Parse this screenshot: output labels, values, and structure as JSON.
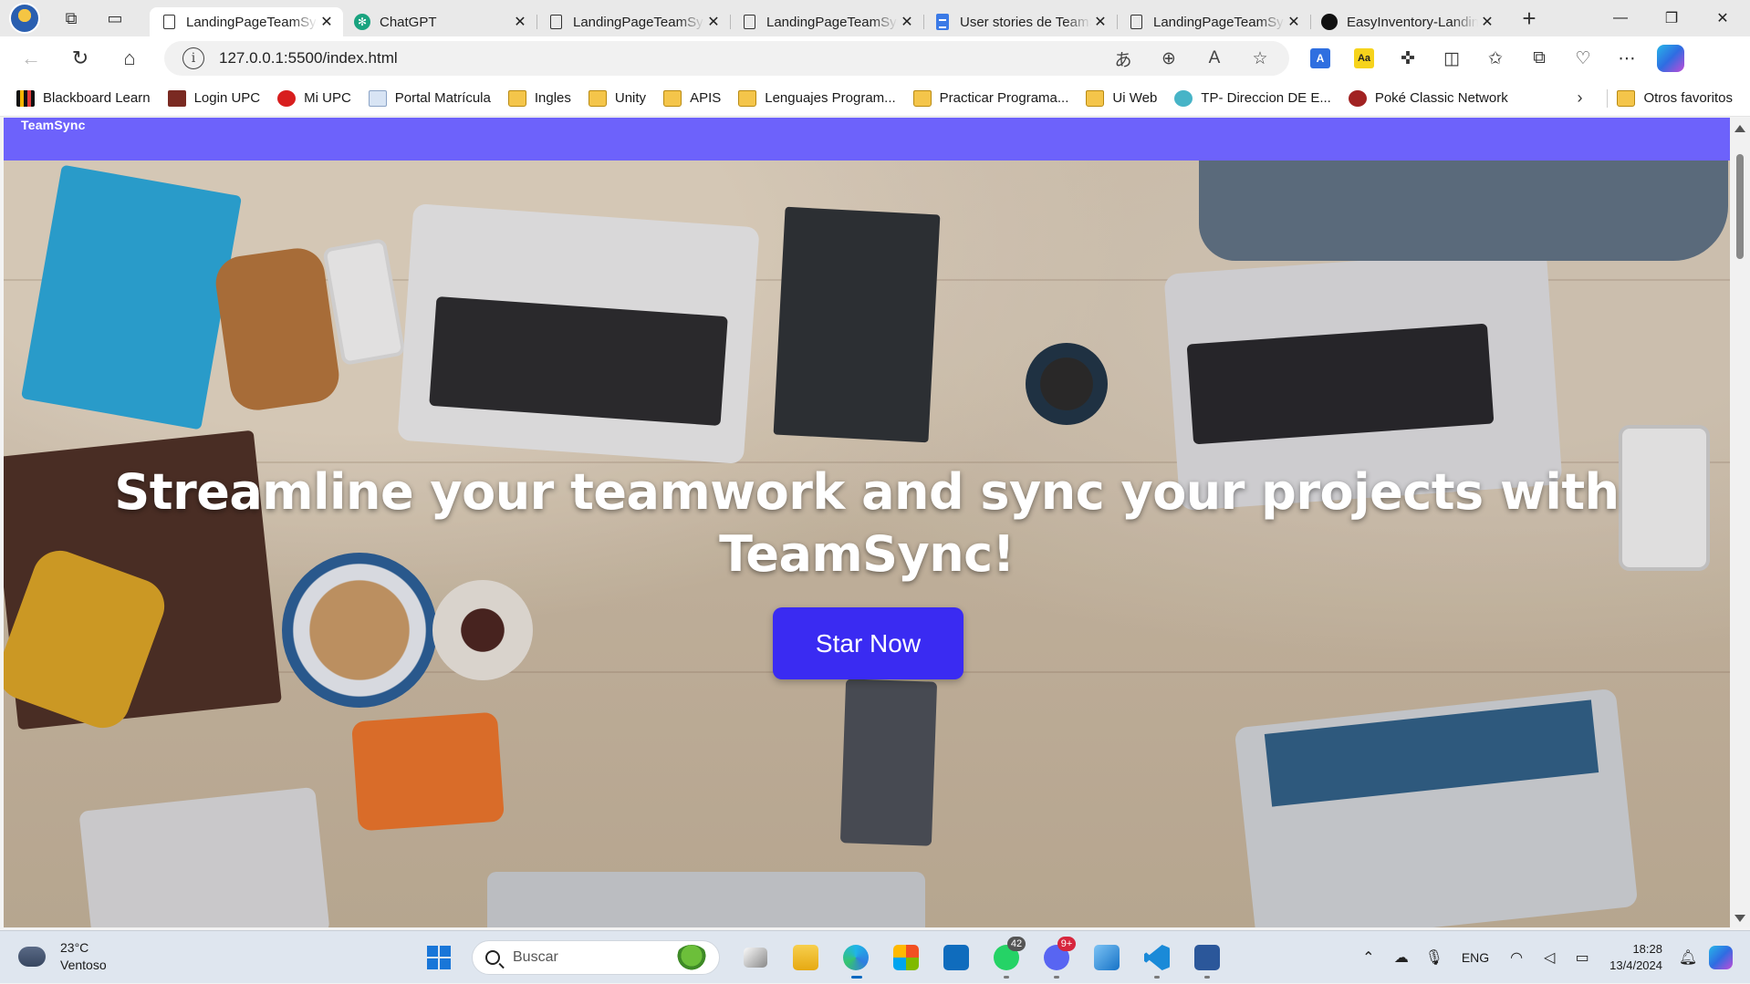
{
  "browser": {
    "tabs": [
      {
        "label": "LandingPageTeamSync",
        "favicon": "document-icon",
        "active": true
      },
      {
        "label": "ChatGPT",
        "favicon": "chatgpt-icon",
        "active": false
      },
      {
        "label": "LandingPageTeamSync",
        "favicon": "document-icon",
        "active": false
      },
      {
        "label": "LandingPageTeamSync",
        "favicon": "document-icon",
        "active": false
      },
      {
        "label": "User stories de TeamSync",
        "favicon": "google-docs-icon",
        "active": false
      },
      {
        "label": "LandingPageTeamSync",
        "favicon": "document-icon",
        "active": false
      },
      {
        "label": "EasyInventory-Landing",
        "favicon": "github-icon",
        "active": false
      }
    ],
    "address": {
      "url": "127.0.0.1:5500/index.html"
    },
    "bookmarks": [
      {
        "label": "Blackboard Learn",
        "icon": "blackboard-icon"
      },
      {
        "label": "Login UPC",
        "icon": "upc-icon"
      },
      {
        "label": "Mi UPC",
        "icon": "mi-upc-icon"
      },
      {
        "label": "Portal Matrícula",
        "icon": "portal-icon"
      },
      {
        "label": "Ingles",
        "icon": "folder-icon"
      },
      {
        "label": "Unity",
        "icon": "folder-icon"
      },
      {
        "label": "APIS",
        "icon": "folder-icon"
      },
      {
        "label": "Lenguajes Program...",
        "icon": "folder-icon"
      },
      {
        "label": "Practicar Programa...",
        "icon": "folder-icon"
      },
      {
        "label": "Ui Web",
        "icon": "folder-icon"
      },
      {
        "label": "TP- Direccion DE E...",
        "icon": "tp-icon"
      },
      {
        "label": "Poké Classic Network",
        "icon": "poke-icon"
      }
    ],
    "other_bookmarks": "Otros favoritos"
  },
  "page": {
    "brand": "TeamSync",
    "hero_title": "Streamline your teamwork and sync your projects with TeamSync!",
    "cta_label": "Star Now",
    "colors": {
      "nav": "#6d62fb",
      "cta": "#3a2bf2"
    }
  },
  "taskbar": {
    "weather": {
      "temp": "23°C",
      "condition": "Ventoso"
    },
    "search_placeholder": "Buscar",
    "badges": {
      "whatsapp": "42",
      "discord": "9+"
    },
    "lang": "ENG",
    "time": "18:28",
    "date": "13/4/2024"
  }
}
